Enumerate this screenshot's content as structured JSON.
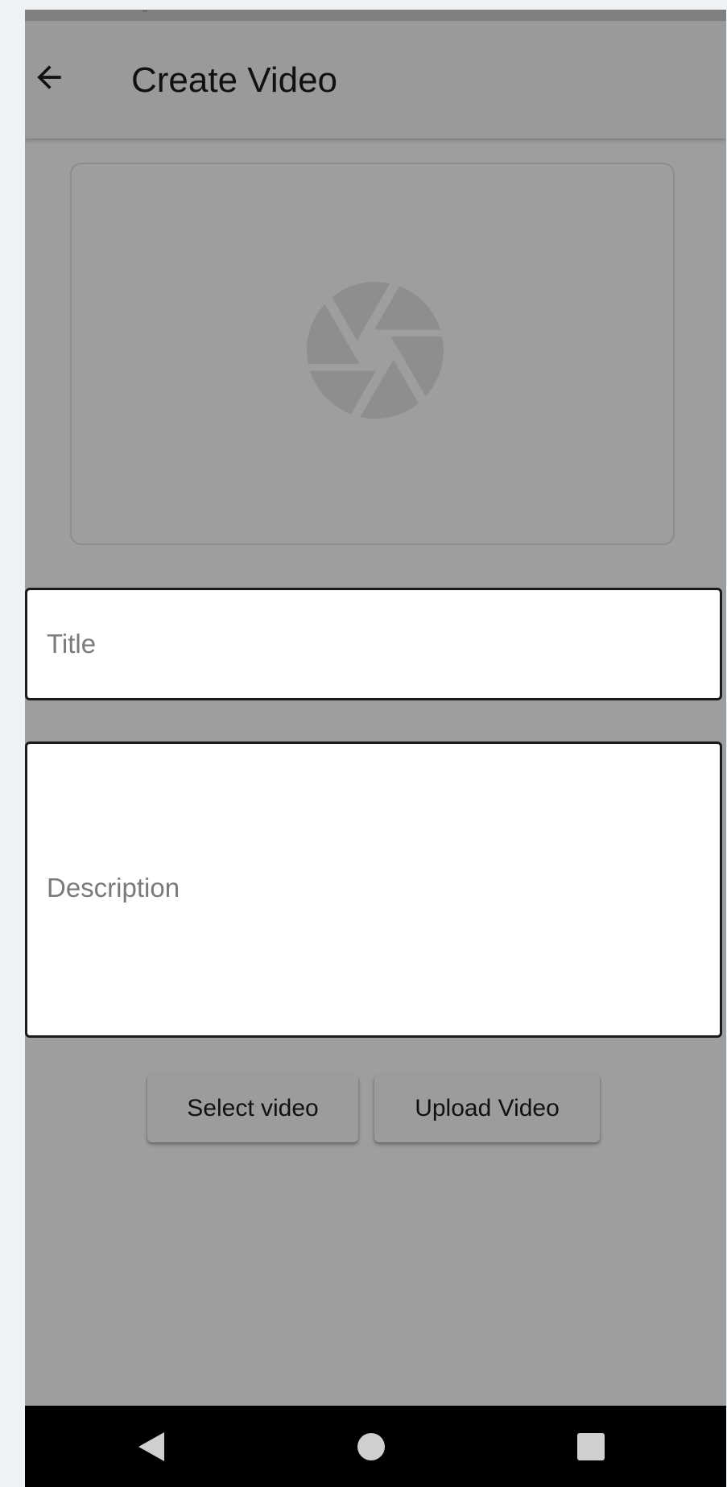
{
  "app_bar": {
    "title": "Create Video",
    "back_icon": "arrow-left-icon"
  },
  "preview": {
    "icon": "camera-shutter-icon"
  },
  "form": {
    "title_placeholder": "Title",
    "description_placeholder": "Description"
  },
  "actions": {
    "select_label": "Select video",
    "upload_label": "Upload Video"
  },
  "nav_bar": {
    "icons": [
      "back-triangle-icon",
      "home-circle-icon",
      "recents-square-icon"
    ]
  },
  "colors": {
    "scrim": "#9e9e9e",
    "field_bg": "#ffffff",
    "nav_bg": "#000000"
  }
}
